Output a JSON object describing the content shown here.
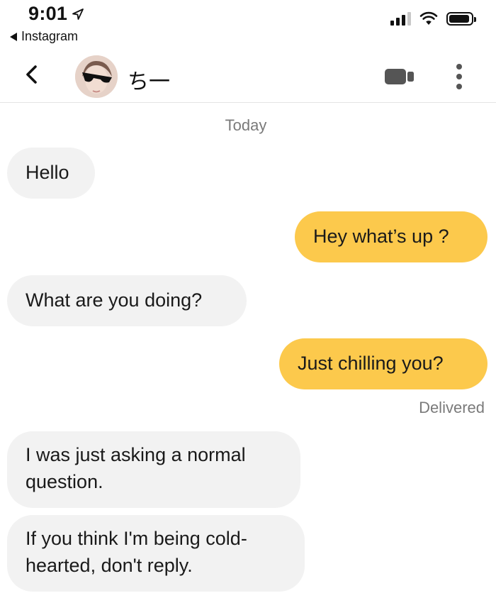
{
  "status_bar": {
    "time": "9:01",
    "back_app_label": "Instagram"
  },
  "header": {
    "contact_name": "ち一",
    "icons": {
      "back": "chevron-left-icon",
      "video": "video-camera-icon",
      "more": "more-vertical-icon"
    }
  },
  "conversation": {
    "date_label": "Today",
    "messages": [
      {
        "direction": "incoming",
        "text": "Hello"
      },
      {
        "direction": "outgoing",
        "text": "Hey what’s up ?"
      },
      {
        "direction": "incoming",
        "text": "What are you doing?"
      },
      {
        "direction": "outgoing",
        "text": "Just chilling you?"
      },
      {
        "direction": "incoming",
        "text": "I was just asking a normal question."
      },
      {
        "direction": "incoming",
        "text": "If you think I'm being cold-hearted, don't reply."
      }
    ],
    "delivered_label": "Delivered"
  },
  "colors": {
    "outgoing_bubble": "#fcc94c",
    "incoming_bubble": "#f2f2f2",
    "meta_text": "#7a7a7a"
  }
}
